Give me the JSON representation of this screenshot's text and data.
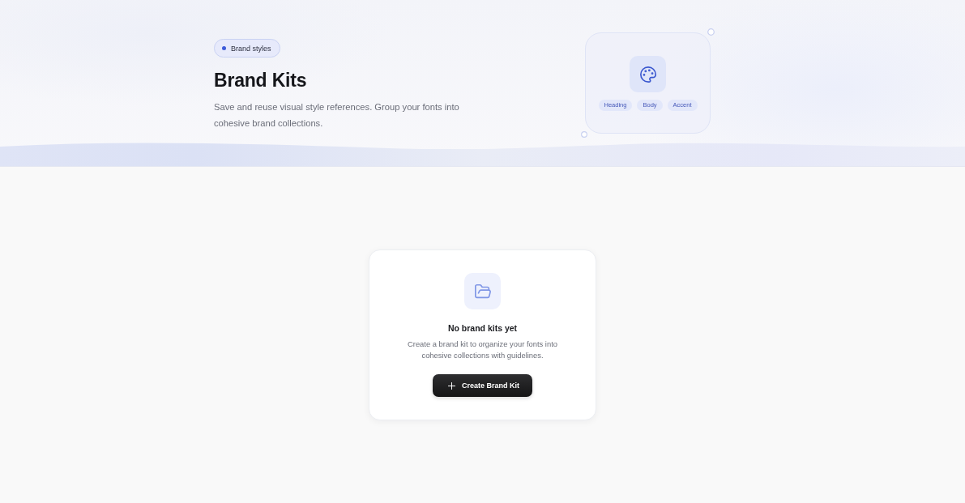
{
  "header": {
    "badge": "Brand styles",
    "title": "Brand Kits",
    "description": "Save and reuse visual style references. Group your fonts into cohesive brand collections.",
    "illustration": {
      "chips": [
        "Heading",
        "Body",
        "Accent"
      ]
    }
  },
  "empty_state": {
    "title": "No brand kits yet",
    "description": "Create a brand kit to organize your fonts into cohesive collections with guidelines.",
    "button": "Create Brand Kit"
  }
}
